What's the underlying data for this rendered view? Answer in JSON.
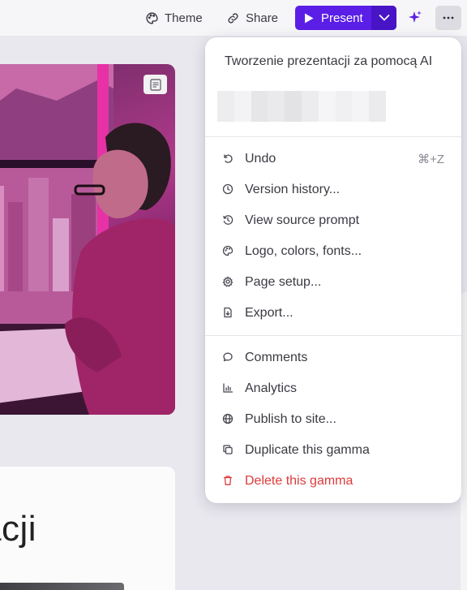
{
  "toolbar": {
    "theme_label": "Theme",
    "share_label": "Share",
    "present_label": "Present",
    "accent_color": "#5b1ee6"
  },
  "canvas": {
    "heading_fragment": "acji"
  },
  "menu": {
    "title": "Tworzenie prezentacji za pomocą AI",
    "items_group1": [
      {
        "label": "Undo",
        "icon": "undo-icon",
        "shortcut": "⌘+Z"
      },
      {
        "label": "Version history...",
        "icon": "clock-icon"
      },
      {
        "label": "View source prompt",
        "icon": "history-icon"
      },
      {
        "label": "Logo, colors, fonts...",
        "icon": "palette-icon"
      },
      {
        "label": "Page setup...",
        "icon": "gear-icon"
      },
      {
        "label": "Export...",
        "icon": "export-file-icon"
      }
    ],
    "items_group2": [
      {
        "label": "Comments",
        "icon": "comment-icon"
      },
      {
        "label": "Analytics",
        "icon": "analytics-icon"
      },
      {
        "label": "Publish to site...",
        "icon": "globe-icon"
      },
      {
        "label": "Duplicate this gamma",
        "icon": "copy-icon"
      },
      {
        "label": "Delete this gamma",
        "icon": "trash-icon",
        "danger_color": "#dc3b3b"
      }
    ]
  }
}
